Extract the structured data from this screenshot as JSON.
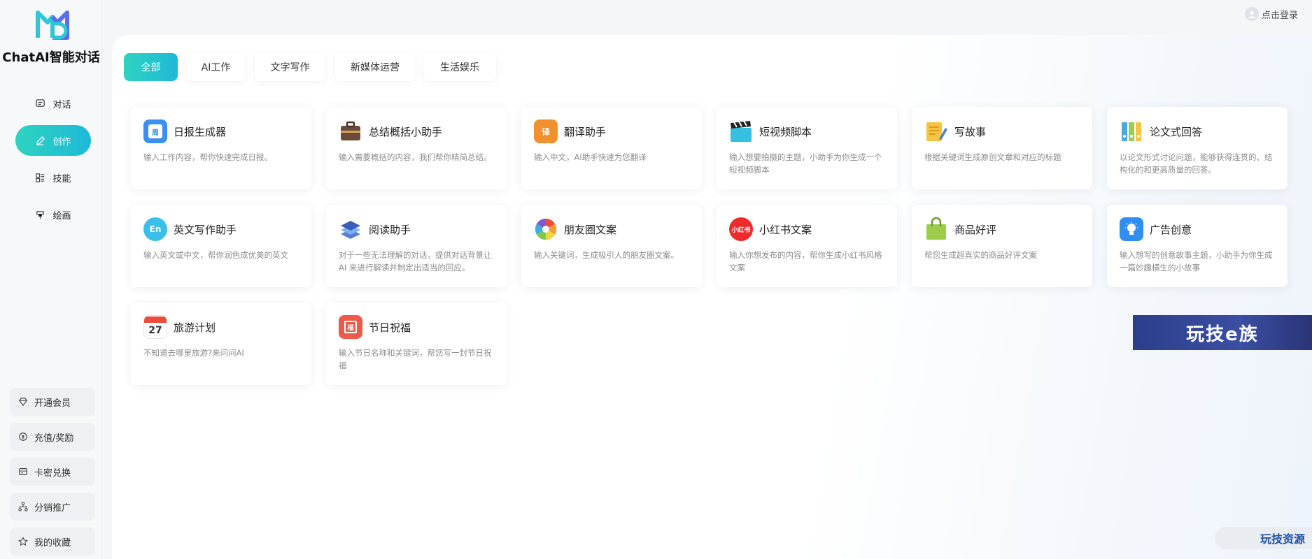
{
  "app": {
    "brand": "ChatAI智能对话"
  },
  "nav": [
    {
      "label": "对话",
      "icon": "chat-icon"
    },
    {
      "label": "创作",
      "icon": "pen-icon",
      "active": true
    },
    {
      "label": "技能",
      "icon": "skills-icon"
    },
    {
      "label": "绘画",
      "icon": "brush-icon"
    }
  ],
  "bottom_menu": [
    {
      "label": "开通会员",
      "icon": "diamond-icon"
    },
    {
      "label": "充值/奖励",
      "icon": "coin-icon"
    },
    {
      "label": "卡密兑换",
      "icon": "card-icon"
    },
    {
      "label": "分销推广",
      "icon": "share-tree-icon"
    },
    {
      "label": "我的收藏",
      "icon": "star-icon"
    }
  ],
  "header": {
    "login_label": "点击登录"
  },
  "tabs": [
    {
      "label": "全部",
      "active": true
    },
    {
      "label": "AI工作"
    },
    {
      "label": "文字写作"
    },
    {
      "label": "新媒体运营"
    },
    {
      "label": "生活娱乐"
    }
  ],
  "cards": [
    {
      "title": "日报生成器",
      "desc": "输入工作内容，帮你快速完成日报。",
      "icon": "daily-report-icon",
      "color": "#3b8ff0",
      "glyph": "周"
    },
    {
      "title": "总结概括小助手",
      "desc": "输入需要概括的内容，我们帮你精简总结。",
      "icon": "briefcase-icon",
      "color": "#6b4a3a",
      "glyph": ""
    },
    {
      "title": "翻译助手",
      "desc": "输入中文，AI助手快速为您翻译",
      "icon": "translate-icon",
      "color": "#f0902e",
      "glyph": "译"
    },
    {
      "title": "短视频脚本",
      "desc": "输入想要拍摄的主题，小助手为你生成一个短视频脚本",
      "icon": "clapperboard-icon",
      "color": "#34c0e0",
      "glyph": ""
    },
    {
      "title": "写故事",
      "desc": "根据关键词生成原创文章和对应的标题",
      "icon": "notepad-icon",
      "color": "#f6c445",
      "glyph": ""
    },
    {
      "title": "论文式回答",
      "desc": "以论文形式讨论问题，能够获得连贯的、结构化的和更高质量的回答。",
      "icon": "binders-icon",
      "color": "#4aa7e0",
      "glyph": ""
    },
    {
      "title": "英文写作助手",
      "desc": "输入英文或中文，帮你润色成优美的英文",
      "icon": "english-icon",
      "color": "#3ac0e8",
      "glyph": "En"
    },
    {
      "title": "阅读助手",
      "desc": "对于一些无法理解的对话，提供对话背景让 AI 来进行解读并制定出适当的回应。",
      "icon": "books-icon",
      "color": "#5a7ed6",
      "glyph": ""
    },
    {
      "title": "朋友圈文案",
      "desc": "输入关键词，生成吸引人的朋友圈文案。",
      "icon": "aperture-icon",
      "color": "#f0a030",
      "glyph": ""
    },
    {
      "title": "小红书文案",
      "desc": "输入你想发布的内容，帮你生成小红书风格文案",
      "icon": "xiaohongshu-icon",
      "color": "#ee2a2a",
      "glyph": "小红书"
    },
    {
      "title": "商品好评",
      "desc": "帮您生成超真实的商品好评文案",
      "icon": "shopping-bag-icon",
      "color": "#9ccc4a",
      "glyph": ""
    },
    {
      "title": "广告创意",
      "desc": "输入想写的创意故事主题，小助手为你生成一篇妙趣横生的小故事",
      "icon": "lightbulb-icon",
      "color": "#2f8ef0",
      "glyph": ""
    },
    {
      "title": "旅游计划",
      "desc": "不知道去哪里旅游?来问问AI",
      "icon": "calendar-icon",
      "color": "#ffffff",
      "glyph": "27"
    },
    {
      "title": "节日祝福",
      "desc": "输入节日名称和关键词，帮您写一封节日祝福",
      "icon": "gift-card-icon",
      "color": "#ee5a4a",
      "glyph": "福"
    }
  ],
  "banner": {
    "text": "玩技e族"
  },
  "watermark": {
    "text": "玩技资源"
  }
}
